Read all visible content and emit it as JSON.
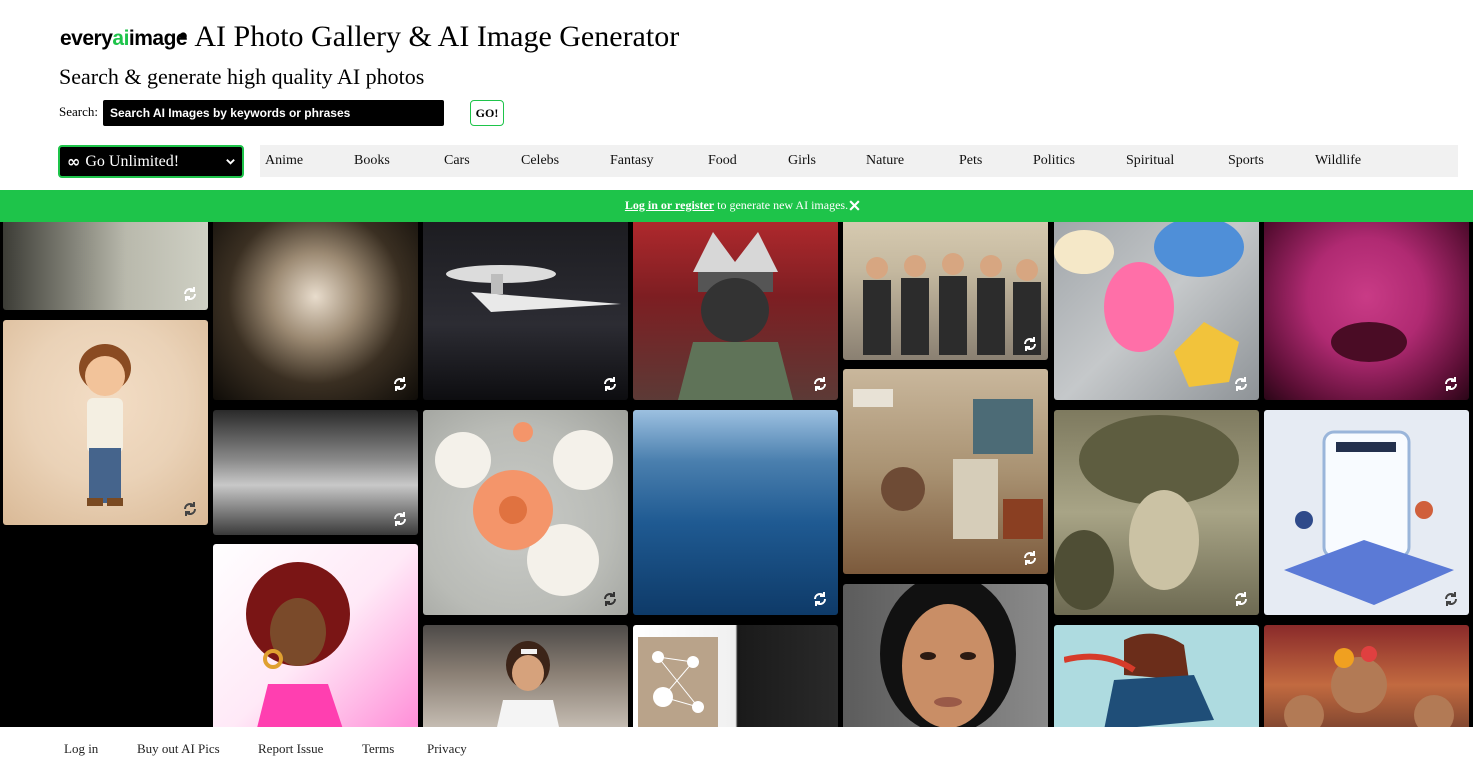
{
  "brand": {
    "logo_part1": "every",
    "logo_part2": "ai",
    "logo_part3": "image"
  },
  "header": {
    "title": "• AI Photo Gallery & AI Image Generator",
    "subtitle": "Search & generate high quality AI photos"
  },
  "search": {
    "label": "Search:",
    "placeholder": "Search AI Images by keywords or phrases",
    "button_label": "GO!"
  },
  "unlimited": {
    "label": "Go Unlimited!"
  },
  "categories": [
    "Anime",
    "Books",
    "Cars",
    "Celebs",
    "Fantasy",
    "Food",
    "Girls",
    "Nature",
    "Pets",
    "Politics",
    "Spiritual",
    "Sports",
    "Wildlife"
  ],
  "banner": {
    "link_text": "Log in or register",
    "text": " to generate new AI images."
  },
  "gallery": {
    "images": [
      "modern glass corridor",
      "cartoon boy with brown hair",
      "skull covered in mushrooms",
      "black and white crowd scene",
      "comic woman with red curly hair",
      "white futuristic spaceship",
      "floral pattern with orange dahlia",
      "tennis player",
      "anime ninja with white hair",
      "ocean waves",
      "network of connected people",
      "supermarket staff group",
      "retro office interior",
      "woman portrait with short black hair",
      "decorated cookies",
      "broccoli head portrait",
      "guitar player illustration",
      "pink moon with lips",
      "students on isometric screen",
      "festival girls with flowers"
    ]
  },
  "footer": {
    "links": [
      "Log in",
      "Buy out AI Pics",
      "Report Issue",
      "Terms",
      "Privacy"
    ]
  },
  "colors": {
    "accent": "#1ec44a",
    "banner_bg": "#1ec44a",
    "gallery_bg": "#000000",
    "category_bar_bg": "#f1f1f1"
  }
}
